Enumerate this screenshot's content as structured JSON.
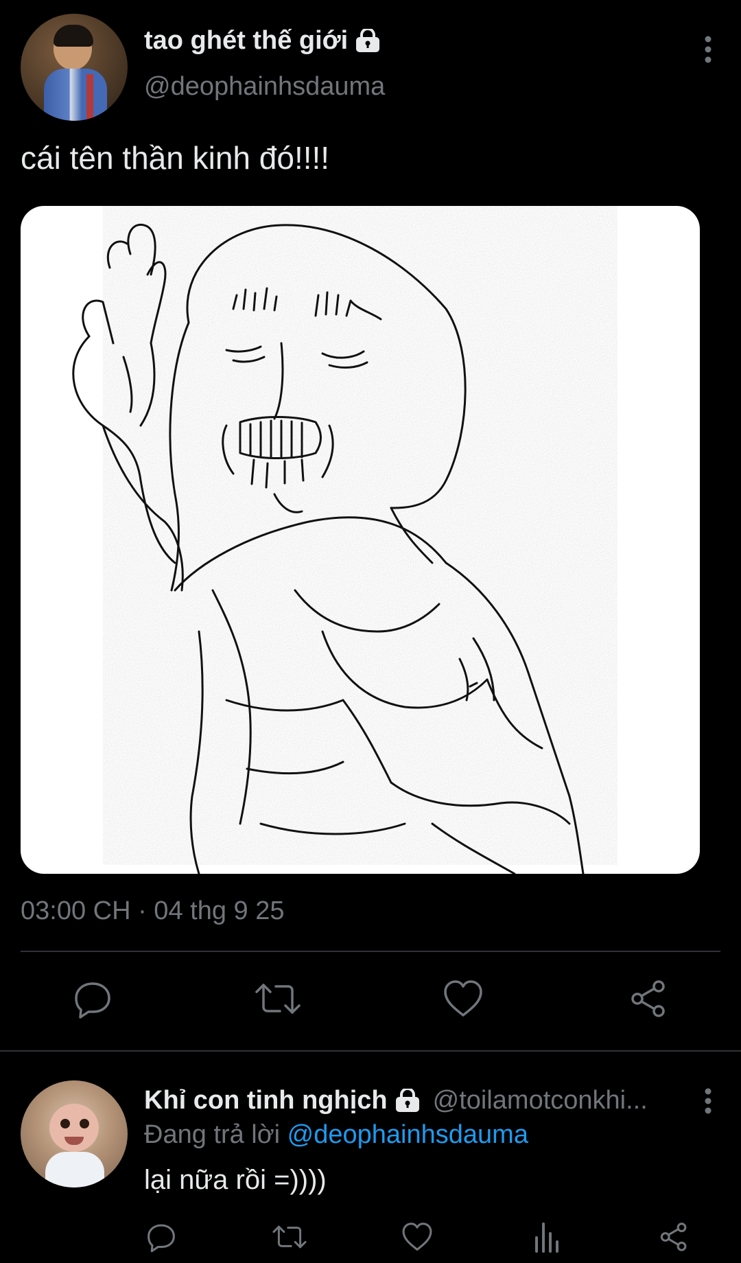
{
  "tweet": {
    "display_name": "tao ghét thế giới",
    "handle": "@deophainhsdauma",
    "text": "cái tên thần kinh đó!!!!",
    "timestamp": "03:00 CH · 04 thg 9 25",
    "icons": {
      "lock": "lock-icon",
      "more": "more-vertical-icon",
      "reply": "reply-icon",
      "retweet": "retweet-icon",
      "like": "heart-icon",
      "share": "share-icon"
    }
  },
  "reply": {
    "display_name": "Khỉ con tinh nghịch",
    "handle": "@toilamotconkhi...",
    "replying_prefix": "Đang trả lời",
    "replying_to": "@deophainhsdauma",
    "text": "lại nữa rồi =))))",
    "icons": {
      "reply": "reply-icon",
      "retweet": "retweet-icon",
      "like": "heart-icon",
      "views": "analytics-icon",
      "share": "share-icon"
    }
  },
  "colors": {
    "background": "#000000",
    "primary_text": "#e7e9ea",
    "secondary_text": "#71767b",
    "link": "#1d9bf0",
    "divider": "#2f3336",
    "icon": "#71767b"
  }
}
